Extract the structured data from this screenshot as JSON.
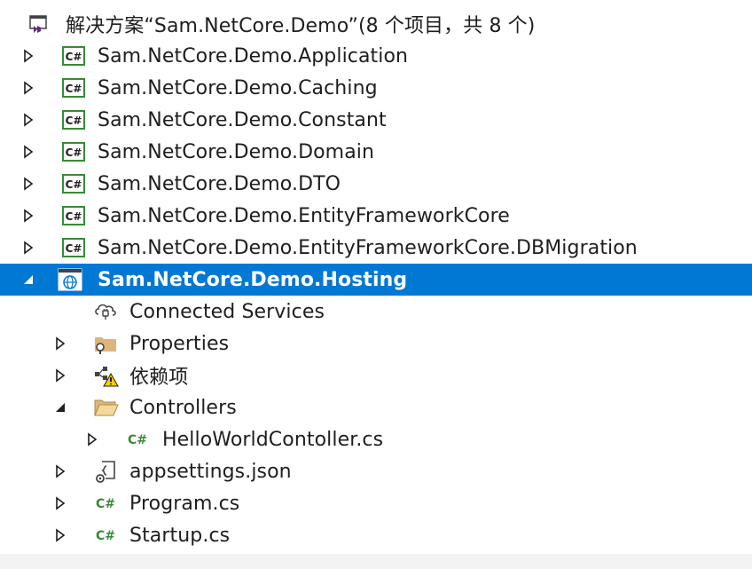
{
  "solution": {
    "title": "解决方案“Sam.NetCore.Demo”(8 个项目，共 8 个)"
  },
  "projects": [
    {
      "label": "Sam.NetCore.Demo.Application"
    },
    {
      "label": "Sam.NetCore.Demo.Caching"
    },
    {
      "label": "Sam.NetCore.Demo.Constant"
    },
    {
      "label": "Sam.NetCore.Demo.Domain"
    },
    {
      "label": "Sam.NetCore.Demo.DTO"
    },
    {
      "label": "Sam.NetCore.Demo.EntityFrameworkCore"
    },
    {
      "label": "Sam.NetCore.Demo.EntityFrameworkCore.DBMigration"
    },
    {
      "label": "Sam.NetCore.Demo.Hosting"
    }
  ],
  "hosting": {
    "connected_services": "Connected Services",
    "properties": "Properties",
    "dependencies": "依赖项",
    "controllers": "Controllers",
    "controller_file": "HelloWorldContoller.cs",
    "appsettings": "appsettings.json",
    "program": "Program.cs",
    "startup": "Startup.cs"
  },
  "colors": {
    "selection": "#0078d4",
    "csharp_green": "#388a34",
    "folder": "#dcb67a",
    "warning": "#ffcc00",
    "vs_purple": "#68217a"
  },
  "icons": {
    "solution": "solution-icon",
    "project": "csharp-project-icon",
    "web_project": "web-project-icon",
    "csharp_file": "csharp-file-icon"
  }
}
